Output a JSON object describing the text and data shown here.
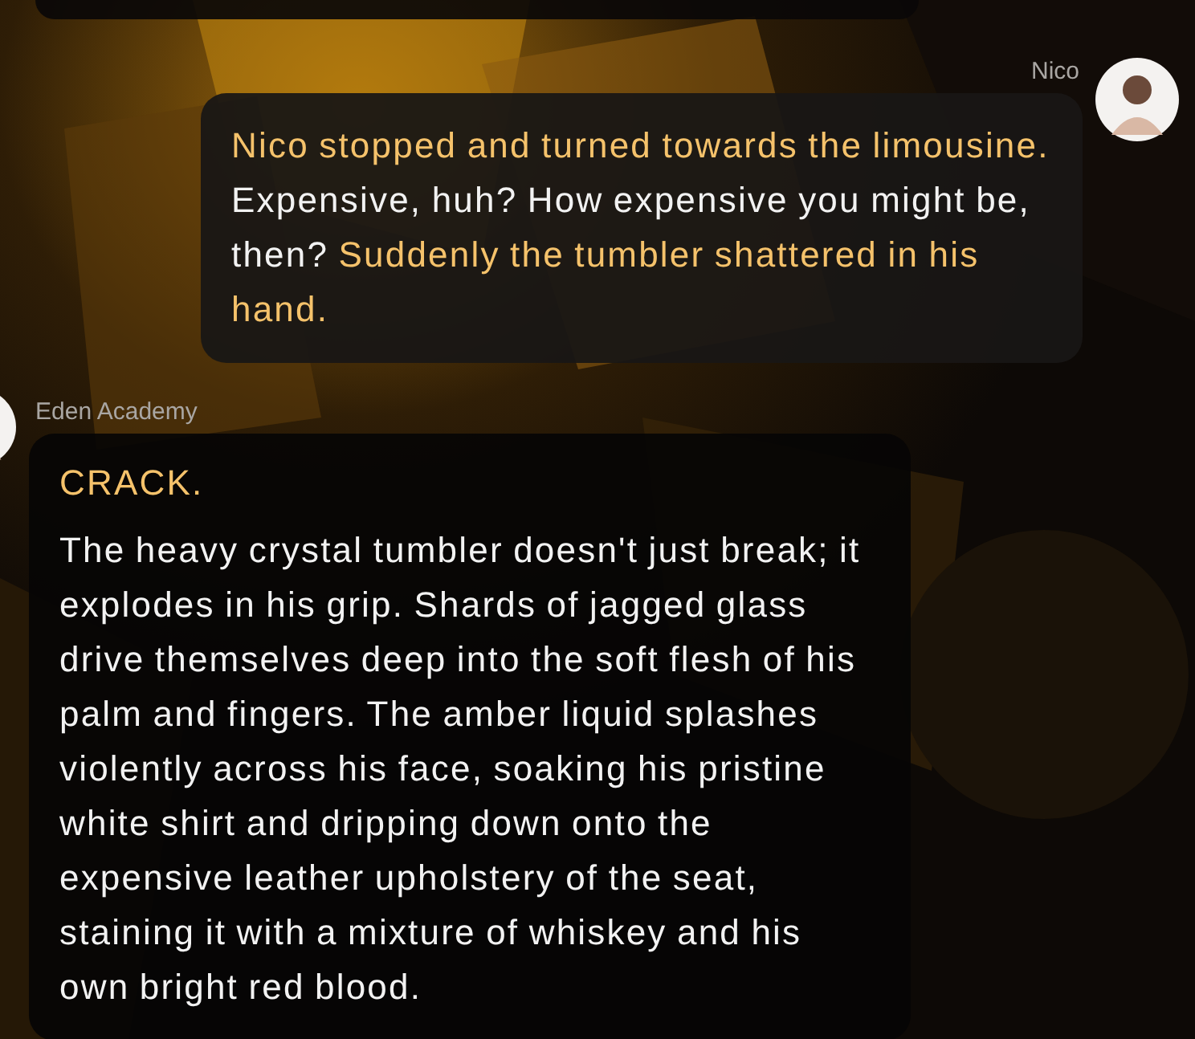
{
  "messages": [
    {
      "sender": "Nico",
      "outgoing": true,
      "paragraphs": [
        [
          {
            "kind": "narration",
            "text": "Nico stopped and turned towards the limousine."
          },
          {
            "kind": "speech",
            "text": " Expensive, huh? How expensive you might be, then?"
          },
          {
            "kind": "narration",
            "text": " Suddenly the tumbler shattered in his hand."
          }
        ]
      ]
    },
    {
      "sender": "Eden Academy",
      "outgoing": false,
      "paragraphs": [
        [
          {
            "kind": "narration",
            "text": "CRACK."
          }
        ],
        [
          {
            "kind": "speech",
            "text": "The heavy crystal tumbler doesn't just break; it explodes in his grip. Shards of jagged glass drive themselves deep into the soft flesh of his palm and fingers. The amber liquid splashes violently across his face, soaking his pristine white shirt and dripping down onto the expensive leather upholstery of the seat, staining it with a mixture of whiskey and his own bright red blood."
          }
        ]
      ]
    }
  ]
}
